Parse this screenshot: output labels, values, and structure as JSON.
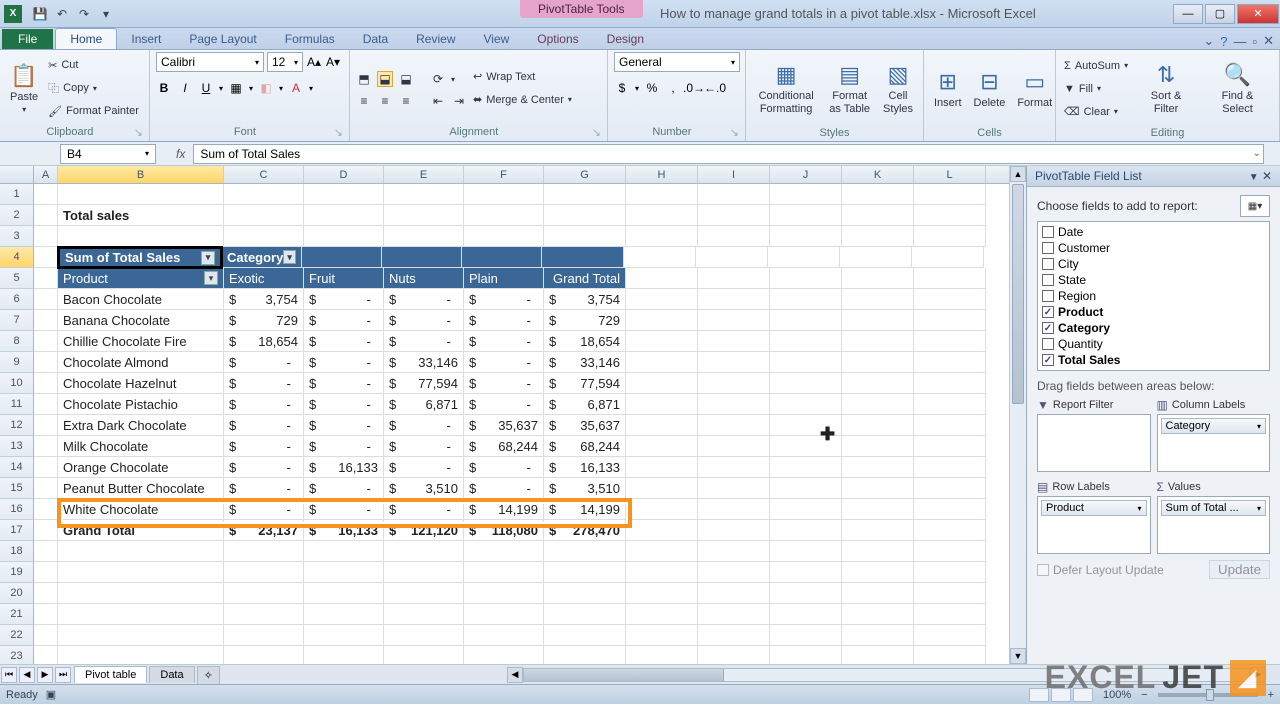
{
  "window": {
    "app": "X",
    "pivot_tools": "PivotTable Tools",
    "title": "How to manage grand totals in a pivot table.xlsx - Microsoft Excel"
  },
  "tabs": {
    "file": "File",
    "home": "Home",
    "insert": "Insert",
    "page_layout": "Page Layout",
    "formulas": "Formulas",
    "data": "Data",
    "review": "Review",
    "view": "View",
    "options": "Options",
    "design": "Design"
  },
  "ribbon": {
    "clipboard": {
      "paste": "Paste",
      "cut": "Cut",
      "copy": "Copy",
      "painter": "Format Painter",
      "label": "Clipboard"
    },
    "font": {
      "name": "Calibri",
      "size": "12",
      "label": "Font"
    },
    "alignment": {
      "wrap": "Wrap Text",
      "merge": "Merge & Center",
      "label": "Alignment"
    },
    "number": {
      "format": "General",
      "label": "Number"
    },
    "styles": {
      "cond": "Conditional Formatting",
      "table": "Format as Table",
      "cell": "Cell Styles",
      "label": "Styles"
    },
    "cells": {
      "insert": "Insert",
      "delete": "Delete",
      "format": "Format",
      "label": "Cells"
    },
    "editing": {
      "autosum": "AutoSum",
      "fill": "Fill",
      "clear": "Clear",
      "sort": "Sort & Filter",
      "find": "Find & Select",
      "label": "Editing"
    }
  },
  "name_box": "B4",
  "formula": "Sum of Total Sales",
  "columns": [
    "A",
    "B",
    "C",
    "D",
    "E",
    "F",
    "G",
    "H",
    "I",
    "J",
    "K",
    "L"
  ],
  "title_cell": "Total sales",
  "pivot": {
    "corner": "Sum of Total Sales",
    "col_label": "Category",
    "row_label": "Product",
    "cols": [
      "Exotic",
      "Fruit",
      "Nuts",
      "Plain",
      "Grand Total"
    ],
    "rows": [
      {
        "p": "Bacon Chocolate",
        "v": [
          "3,754",
          "-",
          "-",
          "-",
          "3,754"
        ]
      },
      {
        "p": "Banana Chocolate",
        "v": [
          "729",
          "-",
          "-",
          "-",
          "729"
        ]
      },
      {
        "p": "Chillie Chocolate Fire",
        "v": [
          "18,654",
          "-",
          "-",
          "-",
          "18,654"
        ]
      },
      {
        "p": "Chocolate Almond",
        "v": [
          "-",
          "-",
          "33,146",
          "-",
          "33,146"
        ]
      },
      {
        "p": "Chocolate Hazelnut",
        "v": [
          "-",
          "-",
          "77,594",
          "-",
          "77,594"
        ]
      },
      {
        "p": "Chocolate Pistachio",
        "v": [
          "-",
          "-",
          "6,871",
          "-",
          "6,871"
        ]
      },
      {
        "p": "Extra Dark Chocolate",
        "v": [
          "-",
          "-",
          "-",
          "35,637",
          "35,637"
        ]
      },
      {
        "p": "Milk Chocolate",
        "v": [
          "-",
          "-",
          "-",
          "68,244",
          "68,244"
        ]
      },
      {
        "p": "Orange Chocolate",
        "v": [
          "-",
          "16,133",
          "-",
          "-",
          "16,133"
        ]
      },
      {
        "p": "Peanut Butter Chocolate",
        "v": [
          "-",
          "-",
          "3,510",
          "-",
          "3,510"
        ]
      },
      {
        "p": "White Chocolate",
        "v": [
          "-",
          "-",
          "-",
          "14,199",
          "14,199"
        ]
      }
    ],
    "grand": {
      "label": "Grand Total",
      "v": [
        "23,137",
        "16,133",
        "121,120",
        "118,080",
        "278,470"
      ]
    }
  },
  "pane": {
    "title": "PivotTable Field List",
    "choose": "Choose fields to add to report:",
    "fields": [
      {
        "n": "Date",
        "c": false
      },
      {
        "n": "Customer",
        "c": false
      },
      {
        "n": "City",
        "c": false
      },
      {
        "n": "State",
        "c": false
      },
      {
        "n": "Region",
        "c": false
      },
      {
        "n": "Product",
        "c": true
      },
      {
        "n": "Category",
        "c": true
      },
      {
        "n": "Quantity",
        "c": false
      },
      {
        "n": "Total Sales",
        "c": true
      }
    ],
    "drag": "Drag fields between areas below:",
    "areas": {
      "report": "Report Filter",
      "column": "Column Labels",
      "row": "Row Labels",
      "values": "Values",
      "col_pill": "Category",
      "row_pill": "Product",
      "val_pill": "Sum of Total ..."
    },
    "defer": "Defer Layout Update",
    "update": "Update"
  },
  "sheets": {
    "active": "Pivot table",
    "other": "Data"
  },
  "status": {
    "ready": "Ready",
    "zoom": "100%"
  },
  "watermark": {
    "a": "EXCEL",
    "b": "JET"
  }
}
